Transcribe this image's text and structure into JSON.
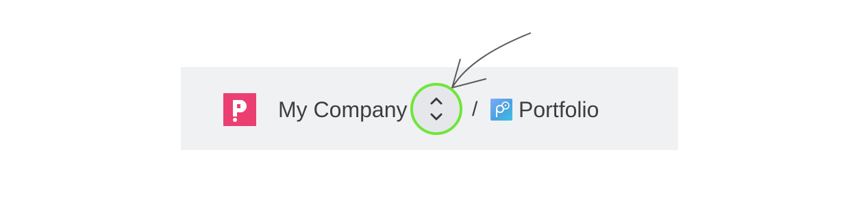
{
  "breadcrumb": {
    "company_name": "My Company",
    "separator": "/",
    "project_name": "Portfolio"
  },
  "icons": {
    "company_logo": "company-logo-icon",
    "switcher": "chevron-up-down-icon",
    "project": "portfolio-icon",
    "annotation": "arrow-pointer"
  },
  "colors": {
    "logo_background": "#ea3f70",
    "highlight_ring": "#6fe63a",
    "bar_background": "#f0f1f3",
    "text": "#3e3e40"
  }
}
